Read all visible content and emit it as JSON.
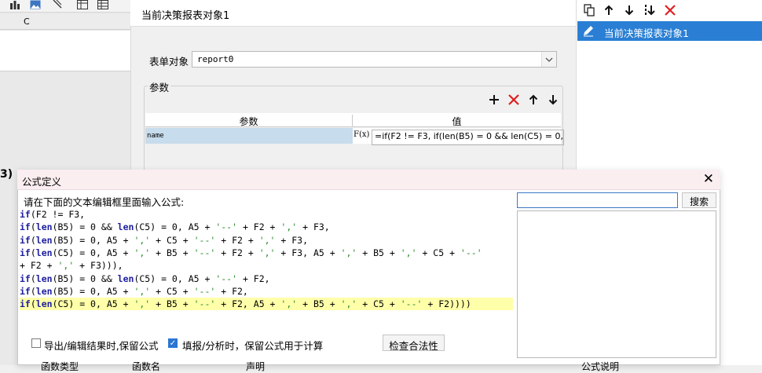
{
  "left_sheet": {
    "column_header": "C",
    "row_marker": "3)"
  },
  "property_panel": {
    "title": "当前决策报表对象1",
    "form_object_label": "表单对象",
    "form_object_value": "report0",
    "params_label": "参数",
    "table_headers": [
      "参数",
      "值"
    ],
    "rows": [
      {
        "name": "name",
        "fx": "F(x)",
        "value": "=if(F2 != F3,  if(len(B5) = 0 && len(C5) = 0, A"
      }
    ]
  },
  "object_panel": {
    "items": [
      {
        "label": "当前决策报表对象1",
        "selected": true
      }
    ]
  },
  "dialog": {
    "title": "公式定义",
    "close_symbol": "✕",
    "prompt": "请在下面的文本编辑框里面输入公式:",
    "search_value": "",
    "search_button": "搜索",
    "formula_lines": [
      "if(F2 != F3,",
      "if(len(B5) = 0 && len(C5) = 0, A5 + '--' + F2 + ',' + F3,",
      "if(len(B5) = 0, A5 + ',' + C5 + '--' + F2 + ',' + F3,",
      "if(len(C5) = 0, A5 + ',' + B5 + '--' + F2 + ',' + F3, A5 + ',' + B5 + ',' + C5 + '--'",
      "+ F2 + ',' + F3))),",
      "if(len(B5) = 0 && len(C5) = 0, A5 + '--' + F2,",
      "if(len(B5) = 0, A5 + ',' + C5 + '--' + F2,",
      "if(len(C5) = 0, A5 + ',' + B5 + '--' + F2, A5 + ',' + B5 + ',' + C5 + '--' + F2))))"
    ],
    "highlighted_line_index": 7,
    "option_export_label": "导出/编辑结果时,保留公式",
    "option_export_checked": false,
    "option_fill_label": "填报/分析时，保留公式用于计算",
    "option_fill_checked": true,
    "check_button": "检查合法性",
    "bottom_headers": [
      "函数类型",
      "函数名",
      "声明",
      "公式说明"
    ]
  },
  "colors": {
    "accent": "#2a7fd4",
    "selected_row": "#c7dcec",
    "delete_red": "#e02020",
    "highlight_line": "#ffffaa"
  }
}
